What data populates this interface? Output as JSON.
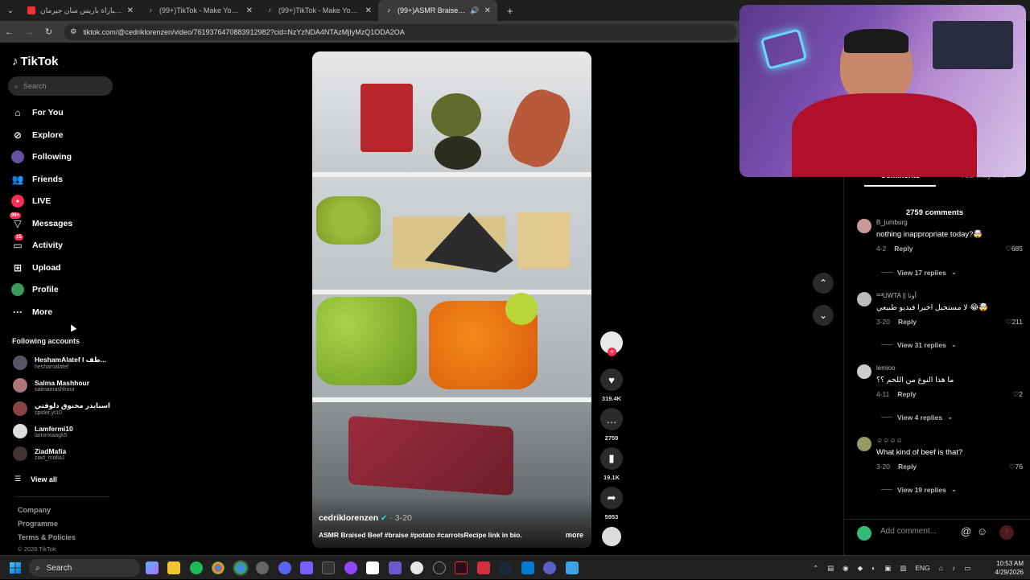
{
  "browser": {
    "tabs": [
      {
        "title": "ملخص مباراة باريس سان جيرمان",
        "active": false
      },
      {
        "title": "(99+)TikTok - Make Your Day",
        "active": false
      },
      {
        "title": "(99+)TikTok - Make Your Day",
        "active": false
      },
      {
        "title": "(99+)ASMR Braised Beef Re",
        "active": true
      }
    ],
    "new_tab": "+",
    "url": "tiktok.com/@cedriklorenzen/video/7619376470883912982?cid=NzYzNDA4NTAzMjIyMzQ1ODA2OA"
  },
  "sidebar": {
    "logo": "TikTok",
    "search_placeholder": "Search",
    "nav": [
      {
        "label": "For You",
        "icon": "home-icon"
      },
      {
        "label": "Explore",
        "icon": "compass-icon"
      },
      {
        "label": "Following",
        "icon": "following-avatar-icon"
      },
      {
        "label": "Friends",
        "icon": "friends-icon"
      },
      {
        "label": "LIVE",
        "icon": "live-icon"
      },
      {
        "label": "Messages",
        "icon": "messages-icon",
        "badge": "99+"
      },
      {
        "label": "Activity",
        "icon": "activity-icon",
        "badge": "15"
      },
      {
        "label": "Upload",
        "icon": "upload-icon"
      },
      {
        "label": "Profile",
        "icon": "profile-avatar-icon"
      },
      {
        "label": "More",
        "icon": "more-icon"
      }
    ],
    "following_title": "Following accounts",
    "accounts": [
      {
        "name": "HeshamAlatef l طف...",
        "handle": "heshamalatef"
      },
      {
        "name": "Salma Mashhour",
        "handle": "salmamashhour"
      },
      {
        "name": "اسبايدر مخنوق دلوقتي",
        "handle": "spider.yt10"
      },
      {
        "name": "Lamfermi10",
        "handle": "laminxwagk5"
      },
      {
        "name": "ZiadMafia",
        "handle": "ziad_mafia1"
      }
    ],
    "view_all": "View all",
    "footer": [
      "Company",
      "Programme",
      "Terms & Policies"
    ],
    "copyright": "© 2026 TikTok"
  },
  "video": {
    "author": "cedriklorenzen",
    "date": "· 3-20",
    "caption": "ASMR Braised Beef #braise #potato #carrotsRecipe link in bio.",
    "more": "more"
  },
  "actions": {
    "likes": "319.4K",
    "comments": "2759",
    "saves": "19.1K",
    "shares": "5953"
  },
  "comments_panel": {
    "tab_comments": "Comments",
    "tab_you_may_like": "You may like",
    "count": "2759 comments",
    "reply_label": "Reply",
    "items": [
      {
        "user": "B_jumburg",
        "text": "nothing inappropriate today?🤯",
        "date": "4-2",
        "likes": "685",
        "replies": "View 17 replies"
      },
      {
        "user": "³¹³UWTA || أوتا",
        "text": "لا مستحيل اخيرا فيديو طبيعي 😂🤯",
        "date": "3-20",
        "likes": "211",
        "replies": "View 31 replies"
      },
      {
        "user": "lemioo",
        "text": "ما هذا النوع من اللحم ؟؟",
        "date": "4-11",
        "likes": "2",
        "replies": "View 4 replies"
      },
      {
        "user": "☺☺☺☺",
        "text": "What kind of beef is that?",
        "date": "3-20",
        "likes": "76",
        "replies": "View 19 replies"
      }
    ],
    "add_placeholder": "Add comment..."
  },
  "taskbar": {
    "search": "Search",
    "lang": "ENG",
    "time": "10:53 AM",
    "date": "4/29/2026"
  },
  "colors": {
    "accent": "#fe2c55",
    "verified": "#20d5ec"
  }
}
